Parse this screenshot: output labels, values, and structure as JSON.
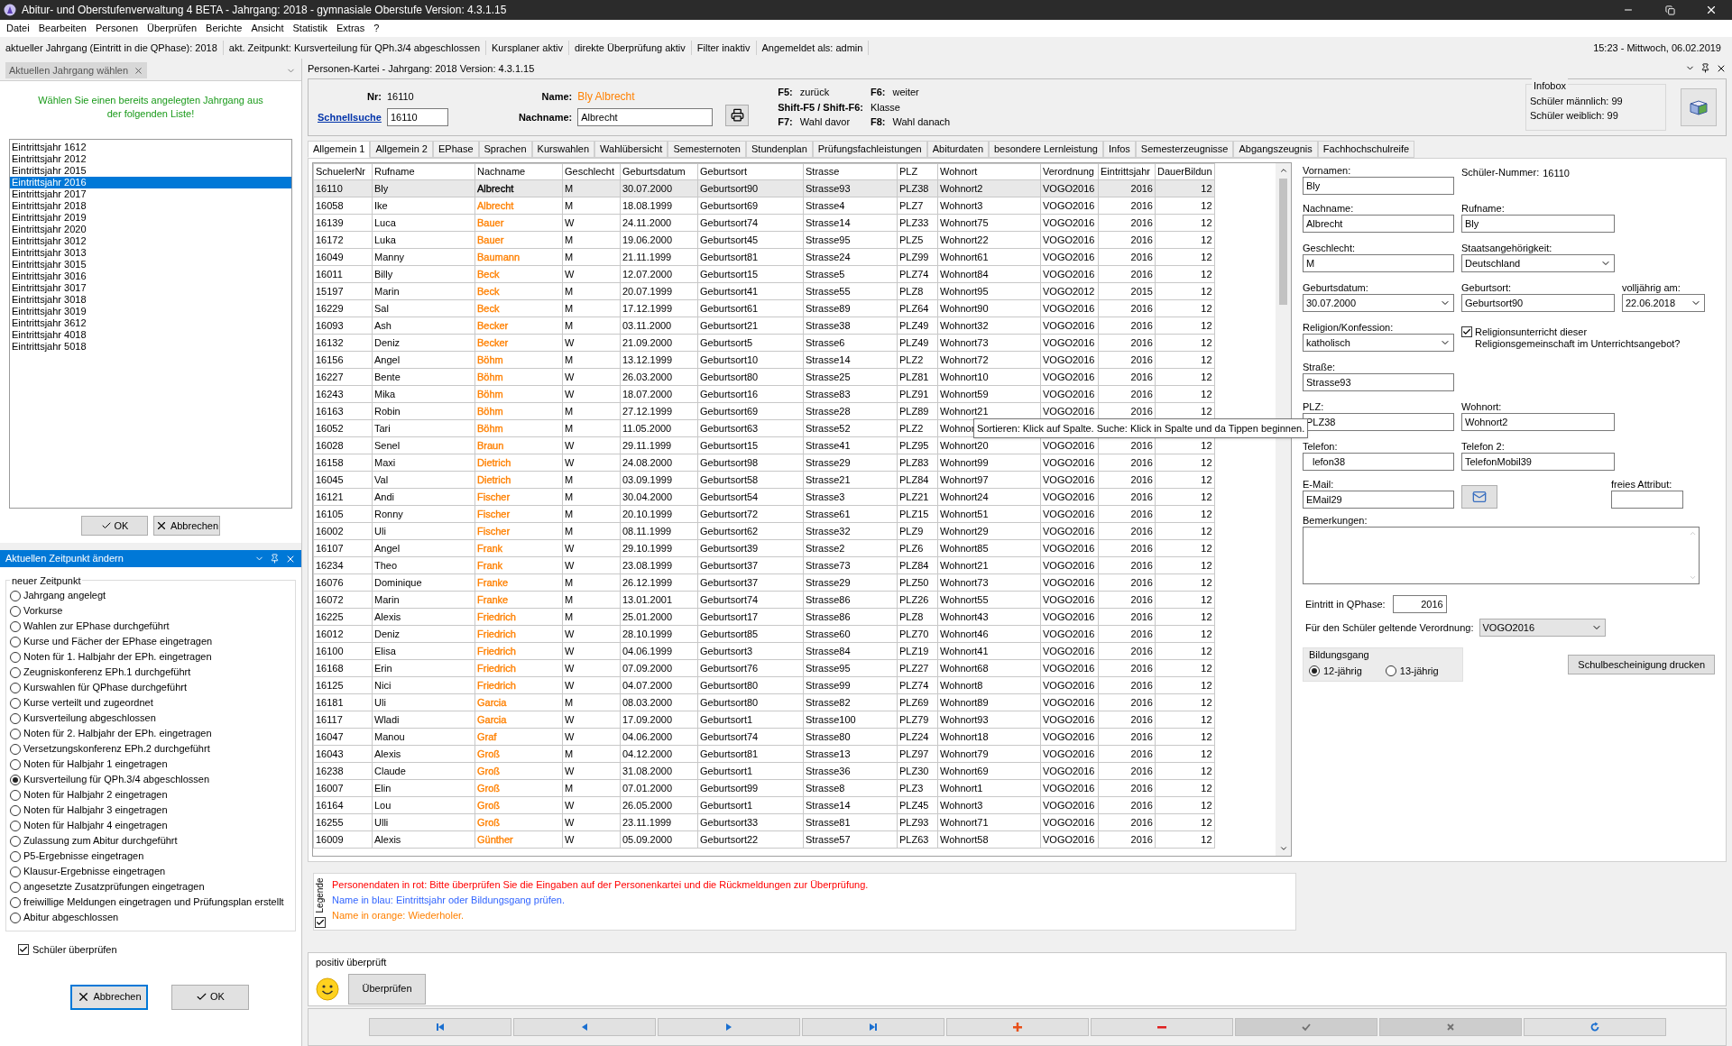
{
  "window": {
    "title": "Abitur- und Oberstufenverwaltung 4 BETA - Jahrgang: 2018 - gymnasiale Oberstufe Version: 4.3.1.15"
  },
  "menu": [
    "Datei",
    "Bearbeiten",
    "Personen",
    "Überprüfen",
    "Berichte",
    "Ansicht",
    "Statistik",
    "Extras",
    "?"
  ],
  "status": [
    "aktueller Jahrgang (Eintritt in die QPhase): 2018",
    "akt. Zeitpunkt: Kursverteilung für QPh.3/4 abgeschlossen",
    "Kursplaner aktiv",
    "direkte Überprüfung aktiv",
    "Filter inaktiv",
    "Angemeldet als: admin"
  ],
  "clock": "15:23 - Mittwoch, 06.02.2019",
  "year_panel": {
    "tab": "Aktuellen Jahrgang wählen",
    "hint": "Wählen Sie einen bereits angelegten Jahrgang  aus der folgenden Liste!",
    "buttons": [
      "OK",
      "Abbrechen"
    ],
    "items": [
      {
        "label": "Eintrittsjahr 1612",
        "selected": false
      },
      {
        "label": "Eintrittsjahr 2012",
        "selected": false
      },
      {
        "label": "Eintrittsjahr 2015",
        "selected": false
      },
      {
        "label": "Eintrittsjahr 2016",
        "selected": true
      },
      {
        "label": "Eintrittsjahr 2017",
        "selected": false
      },
      {
        "label": "Eintrittsjahr 2018",
        "selected": false
      },
      {
        "label": "Eintrittsjahr 2019",
        "selected": false
      },
      {
        "label": "Eintrittsjahr 2020",
        "selected": false
      },
      {
        "label": "Eintrittsjahr 3012",
        "selected": false
      },
      {
        "label": "Eintrittsjahr 3013",
        "selected": false
      },
      {
        "label": "Eintrittsjahr 3015",
        "selected": false
      },
      {
        "label": "Eintrittsjahr 3016",
        "selected": false
      },
      {
        "label": "Eintrittsjahr 3017",
        "selected": false
      },
      {
        "label": "Eintrittsjahr 3018",
        "selected": false
      },
      {
        "label": "Eintrittsjahr 3019",
        "selected": false
      },
      {
        "label": "Eintrittsjahr 3612",
        "selected": false
      },
      {
        "label": "Eintrittsjahr 4018",
        "selected": false
      },
      {
        "label": "Eintrittsjahr 5018",
        "selected": false
      }
    ]
  },
  "time_panel": {
    "title": "Aktuellen Zeitpunkt ändern",
    "group": "neuer Zeitpunkt",
    "check": {
      "label": "Schüler überprüfen",
      "checked": true
    },
    "buttons": [
      "Abbrechen",
      "OK"
    ],
    "options": [
      {
        "label": "Jahrgang angelegt",
        "selected": false
      },
      {
        "label": "Vorkurse",
        "selected": false
      },
      {
        "label": "Wahlen zur EPhase durchgeführt",
        "selected": false
      },
      {
        "label": "Kurse und Fächer der EPhase eingetragen",
        "selected": false
      },
      {
        "label": "Noten für 1. Halbjahr der EPh. eingetragen",
        "selected": false
      },
      {
        "label": "Zeugniskonferenz EPh.1 durchgeführt",
        "selected": false
      },
      {
        "label": "Kurswahlen für QPhase durchgeführt",
        "selected": false
      },
      {
        "label": "Kurse verteilt und zugeordnet",
        "selected": false
      },
      {
        "label": "Kursverteilung abgeschlossen",
        "selected": false
      },
      {
        "label": "Noten für 2. Halbjahr der EPh. eingetragen",
        "selected": false
      },
      {
        "label": "Versetzungskonferenz EPh.2 durchgeführt",
        "selected": false
      },
      {
        "label": "Noten für Halbjahr 1 eingetragen",
        "selected": false
      },
      {
        "label": "Kursverteilung für QPh.3/4 abgeschlossen",
        "selected": true
      },
      {
        "label": "Noten für Halbjahr 2 eingetragen",
        "selected": false
      },
      {
        "label": "Noten für Halbjahr 3 eingetragen",
        "selected": false
      },
      {
        "label": "Noten für Halbjahr 4 eingetragen",
        "selected": false
      },
      {
        "label": "Zulassung zum Abitur durchgeführt",
        "selected": false
      },
      {
        "label": "P5-Ergebnisse eingetragen",
        "selected": false
      },
      {
        "label": "Klausur-Ergebnisse eingetragen",
        "selected": false
      },
      {
        "label": "angesetzte Zusatzprüfungen eingetragen",
        "selected": false
      },
      {
        "label": "freiwillige Meldungen eingetragen und Prüfungsplan erstellt",
        "selected": false
      },
      {
        "label": "Abitur abgeschlossen",
        "selected": false
      }
    ]
  },
  "card": {
    "title": "Personen-Kartei - Jahrgang: 2018 Version: 4.3.1.15",
    "nr_label": "Nr:",
    "nr": "16110",
    "name_label": "Name:",
    "name": "Bly Albrecht",
    "quick_label": "Schnellsuche",
    "quick_value": "16110",
    "surname_label": "Nachname:",
    "surname_value": "Albrecht",
    "shortcuts": [
      [
        {
          "key": "F5:",
          "text": "zurück"
        },
        {
          "key": "F6:",
          "text": "weiter"
        }
      ],
      [
        {
          "key": "Shift-F5 / Shift-F6:",
          "text": "Klasse"
        }
      ],
      [
        {
          "key": "F7:",
          "text": "Wahl davor"
        },
        {
          "key": "F8:",
          "text": "Wahl danach"
        }
      ]
    ],
    "infobox": {
      "title": "Infobox",
      "lines": [
        "Schüler männlich: 99",
        "Schüler weiblich: 99"
      ]
    }
  },
  "tabs": [
    {
      "label": "Allgemein 1",
      "selected": true
    },
    {
      "label": "Allgemein 2",
      "selected": false
    },
    {
      "label": "EPhase",
      "selected": false
    },
    {
      "label": "Sprachen",
      "selected": false
    },
    {
      "label": "Kurswahlen",
      "selected": false
    },
    {
      "label": "Wahlübersicht",
      "selected": false
    },
    {
      "label": "Semesternoten",
      "selected": false
    },
    {
      "label": "Stundenplan",
      "selected": false
    },
    {
      "label": "Prüfungsfachleistungen",
      "selected": false
    },
    {
      "label": "Abiturdaten",
      "selected": false
    },
    {
      "label": "besondere Lernleistung",
      "selected": false
    },
    {
      "label": "Infos",
      "selected": false
    },
    {
      "label": "Semesterzeugnisse",
      "selected": false
    },
    {
      "label": "Abgangszeugnis",
      "selected": false
    },
    {
      "label": "Fachhochschulreife",
      "selected": false
    }
  ],
  "table": {
    "columns": [
      "SchuelerNr",
      "Rufname",
      "Nachname",
      "Geschlecht",
      "Geburtsdatum",
      "Geburtsort",
      "Strasse",
      "PLZ",
      "Wohnort",
      "Verordnung",
      "Eintrittsjahr",
      "DauerBildun"
    ],
    "rows": [
      {
        "selected": true,
        "color": "#000000",
        "cells": [
          "16110",
          "Bly",
          "Albrecht",
          "M",
          "30.07.2000",
          "Geburtsort90",
          "Strasse93",
          "PLZ38",
          "Wohnort2",
          "VOGO2016",
          "2016",
          "12"
        ]
      },
      {
        "selected": false,
        "color": "#ff8000",
        "cells": [
          "16058",
          "Ike",
          "Albrecht",
          "M",
          "18.08.1999",
          "Geburtsort69",
          "Strasse4",
          "PLZ7",
          "Wohnort3",
          "VOGO2016",
          "2016",
          "12"
        ]
      },
      {
        "selected": false,
        "color": "#ff8000",
        "cells": [
          "16139",
          "Luca",
          "Bauer",
          "W",
          "24.11.2000",
          "Geburtsort74",
          "Strasse14",
          "PLZ33",
          "Wohnort75",
          "VOGO2016",
          "2016",
          "12"
        ]
      },
      {
        "selected": false,
        "color": "#ff8000",
        "cells": [
          "16172",
          "Luka",
          "Bauer",
          "M",
          "19.06.2000",
          "Geburtsort45",
          "Strasse95",
          "PLZ5",
          "Wohnort22",
          "VOGO2016",
          "2016",
          "12"
        ]
      },
      {
        "selected": false,
        "color": "#ff8000",
        "cells": [
          "16049",
          "Manny",
          "Baumann",
          "M",
          "21.11.1999",
          "Geburtsort81",
          "Strasse24",
          "PLZ99",
          "Wohnort61",
          "VOGO2016",
          "2016",
          "12"
        ]
      },
      {
        "selected": false,
        "color": "#ff8000",
        "cells": [
          "16011",
          "Billy",
          "Beck",
          "W",
          "12.07.2000",
          "Geburtsort15",
          "Strasse5",
          "PLZ74",
          "Wohnort84",
          "VOGO2016",
          "2016",
          "12"
        ]
      },
      {
        "selected": false,
        "color": "#ff8000",
        "cells": [
          "15197",
          "Marin",
          "Beck",
          "M",
          "20.07.1999",
          "Geburtsort41",
          "Strasse55",
          "PLZ8",
          "Wohnort95",
          "VOGO2012",
          "2015",
          "12"
        ]
      },
      {
        "selected": false,
        "color": "#ff8000",
        "cells": [
          "16229",
          "Sal",
          "Beck",
          "M",
          "17.12.1999",
          "Geburtsort61",
          "Strasse89",
          "PLZ64",
          "Wohnort90",
          "VOGO2016",
          "2016",
          "12"
        ]
      },
      {
        "selected": false,
        "color": "#ff8000",
        "cells": [
          "16093",
          "Ash",
          "Becker",
          "M",
          "03.11.2000",
          "Geburtsort21",
          "Strasse38",
          "PLZ49",
          "Wohnort32",
          "VOGO2016",
          "2016",
          "12"
        ]
      },
      {
        "selected": false,
        "color": "#ff8000",
        "cells": [
          "16132",
          "Deniz",
          "Becker",
          "W",
          "21.09.2000",
          "Geburtsort5",
          "Strasse6",
          "PLZ49",
          "Wohnort73",
          "VOGO2016",
          "2016",
          "12"
        ]
      },
      {
        "selected": false,
        "color": "#ff8000",
        "cells": [
          "16156",
          "Angel",
          "Böhm",
          "M",
          "13.12.1999",
          "Geburtsort10",
          "Strasse14",
          "PLZ2",
          "Wohnort72",
          "VOGO2016",
          "2016",
          "12"
        ]
      },
      {
        "selected": false,
        "color": "#ff8000",
        "cells": [
          "16227",
          "Bente",
          "Böhm",
          "W",
          "26.03.2000",
          "Geburtsort80",
          "Strasse25",
          "PLZ81",
          "Wohnort10",
          "VOGO2016",
          "2016",
          "12"
        ]
      },
      {
        "selected": false,
        "color": "#ff8000",
        "cells": [
          "16243",
          "Mika",
          "Böhm",
          "W",
          "18.07.2000",
          "Geburtsort16",
          "Strasse83",
          "PLZ91",
          "Wohnort59",
          "VOGO2016",
          "2016",
          "12"
        ]
      },
      {
        "selected": false,
        "color": "#ff8000",
        "cells": [
          "16163",
          "Robin",
          "Böhm",
          "M",
          "27.12.1999",
          "Geburtsort69",
          "Strasse28",
          "PLZ89",
          "Wohnort21",
          "VOGO2016",
          "2016",
          "12"
        ]
      },
      {
        "selected": false,
        "color": "#ff8000",
        "cells": [
          "16052",
          "Tari",
          "Böhm",
          "M",
          "11.05.2000",
          "Geburtsort63",
          "Strasse52",
          "PLZ2",
          "Wohnor"
        ]
      },
      {
        "selected": false,
        "color": "#ff8000",
        "cells": [
          "16028",
          "Senel",
          "Braun",
          "W",
          "29.11.1999",
          "Geburtsort15",
          "Strasse41",
          "PLZ95",
          "Wohnort20",
          "VOGO2016",
          "2016",
          "12"
        ]
      },
      {
        "selected": false,
        "color": "#ff8000",
        "cells": [
          "16158",
          "Maxi",
          "Dietrich",
          "W",
          "24.08.2000",
          "Geburtsort98",
          "Strasse29",
          "PLZ83",
          "Wohnort99",
          "VOGO2016",
          "2016",
          "12"
        ]
      },
      {
        "selected": false,
        "color": "#ff8000",
        "cells": [
          "16045",
          "Val",
          "Dietrich",
          "M",
          "03.09.1999",
          "Geburtsort58",
          "Strasse21",
          "PLZ84",
          "Wohnort97",
          "VOGO2016",
          "2016",
          "12"
        ]
      },
      {
        "selected": false,
        "color": "#ff8000",
        "cells": [
          "16121",
          "Andi",
          "Fischer",
          "M",
          "30.04.2000",
          "Geburtsort54",
          "Strasse3",
          "PLZ21",
          "Wohnort24",
          "VOGO2016",
          "2016",
          "12"
        ]
      },
      {
        "selected": false,
        "color": "#ff8000",
        "cells": [
          "16105",
          "Ronny",
          "Fischer",
          "M",
          "20.10.1999",
          "Geburtsort72",
          "Strasse61",
          "PLZ15",
          "Wohnort51",
          "VOGO2016",
          "2016",
          "12"
        ]
      },
      {
        "selected": false,
        "color": "#ff8000",
        "cells": [
          "16002",
          "Uli",
          "Fischer",
          "M",
          "08.11.1999",
          "Geburtsort62",
          "Strasse32",
          "PLZ9",
          "Wohnort29",
          "VOGO2016",
          "2016",
          "12"
        ]
      },
      {
        "selected": false,
        "color": "#ff8000",
        "cells": [
          "16107",
          "Angel",
          "Frank",
          "W",
          "29.10.1999",
          "Geburtsort39",
          "Strasse2",
          "PLZ6",
          "Wohnort85",
          "VOGO2016",
          "2016",
          "12"
        ]
      },
      {
        "selected": false,
        "color": "#ff8000",
        "cells": [
          "16234",
          "Theo",
          "Frank",
          "W",
          "23.08.1999",
          "Geburtsort37",
          "Strasse73",
          "PLZ84",
          "Wohnort21",
          "VOGO2016",
          "2016",
          "12"
        ]
      },
      {
        "selected": false,
        "color": "#ff8000",
        "cells": [
          "16076",
          "Dominique",
          "Franke",
          "M",
          "26.12.1999",
          "Geburtsort37",
          "Strasse29",
          "PLZ50",
          "Wohnort73",
          "VOGO2016",
          "2016",
          "12"
        ]
      },
      {
        "selected": false,
        "color": "#ff8000",
        "cells": [
          "16072",
          "Marin",
          "Franke",
          "M",
          "13.01.2001",
          "Geburtsort74",
          "Strasse86",
          "PLZ26",
          "Wohnort55",
          "VOGO2016",
          "2016",
          "12"
        ]
      },
      {
        "selected": false,
        "color": "#ff8000",
        "cells": [
          "16225",
          "Alexis",
          "Friedrich",
          "M",
          "25.01.2000",
          "Geburtsort17",
          "Strasse86",
          "PLZ8",
          "Wohnort43",
          "VOGO2016",
          "2016",
          "12"
        ]
      },
      {
        "selected": false,
        "color": "#ff8000",
        "cells": [
          "16012",
          "Deniz",
          "Friedrich",
          "W",
          "28.10.1999",
          "Geburtsort85",
          "Strasse60",
          "PLZ70",
          "Wohnort46",
          "VOGO2016",
          "2016",
          "12"
        ]
      },
      {
        "selected": false,
        "color": "#ff8000",
        "cells": [
          "16100",
          "Elisa",
          "Friedrich",
          "W",
          "04.06.1999",
          "Geburtsort3",
          "Strasse84",
          "PLZ19",
          "Wohnort41",
          "VOGO2016",
          "2016",
          "12"
        ]
      },
      {
        "selected": false,
        "color": "#ff8000",
        "cells": [
          "16168",
          "Erin",
          "Friedrich",
          "W",
          "07.09.2000",
          "Geburtsort76",
          "Strasse95",
          "PLZ27",
          "Wohnort68",
          "VOGO2016",
          "2016",
          "12"
        ]
      },
      {
        "selected": false,
        "color": "#ff8000",
        "cells": [
          "16125",
          "Nici",
          "Friedrich",
          "W",
          "04.07.2000",
          "Geburtsort80",
          "Strasse99",
          "PLZ74",
          "Wohnort8",
          "VOGO2016",
          "2016",
          "12"
        ]
      },
      {
        "selected": false,
        "color": "#ff8000",
        "cells": [
          "16181",
          "Uli",
          "Garcia",
          "M",
          "08.03.2000",
          "Geburtsort80",
          "Strasse82",
          "PLZ69",
          "Wohnort89",
          "VOGO2016",
          "2016",
          "12"
        ]
      },
      {
        "selected": false,
        "color": "#ff8000",
        "cells": [
          "16117",
          "Wladi",
          "Garcia",
          "W",
          "17.09.2000",
          "Geburtsort1",
          "Strasse100",
          "PLZ79",
          "Wohnort93",
          "VOGO2016",
          "2016",
          "12"
        ]
      },
      {
        "selected": false,
        "color": "#ff8000",
        "cells": [
          "16047",
          "Manou",
          "Graf",
          "W",
          "04.06.2000",
          "Geburtsort74",
          "Strasse80",
          "PLZ24",
          "Wohnort18",
          "VOGO2016",
          "2016",
          "12"
        ]
      },
      {
        "selected": false,
        "color": "#ff8000",
        "cells": [
          "16043",
          "Alexis",
          "Groß",
          "M",
          "04.12.2000",
          "Geburtsort81",
          "Strasse13",
          "PLZ97",
          "Wohnort79",
          "VOGO2016",
          "2016",
          "12"
        ]
      },
      {
        "selected": false,
        "color": "#ff8000",
        "cells": [
          "16238",
          "Claude",
          "Groß",
          "W",
          "31.08.2000",
          "Geburtsort1",
          "Strasse36",
          "PLZ30",
          "Wohnort69",
          "VOGO2016",
          "2016",
          "12"
        ]
      },
      {
        "selected": false,
        "color": "#ff8000",
        "cells": [
          "16007",
          "Elin",
          "Groß",
          "M",
          "07.01.2000",
          "Geburtsort99",
          "Strasse8",
          "PLZ3",
          "Wohnort1",
          "VOGO2016",
          "2016",
          "12"
        ]
      },
      {
        "selected": false,
        "color": "#ff8000",
        "cells": [
          "16164",
          "Lou",
          "Groß",
          "W",
          "26.05.2000",
          "Geburtsort1",
          "Strasse14",
          "PLZ45",
          "Wohnort3",
          "VOGO2016",
          "2016",
          "12"
        ]
      },
      {
        "selected": false,
        "color": "#ff8000",
        "cells": [
          "16255",
          "Ulli",
          "Groß",
          "W",
          "23.11.1999",
          "Geburtsort33",
          "Strasse81",
          "PLZ93",
          "Wohnort71",
          "VOGO2016",
          "2016",
          "12"
        ]
      },
      {
        "selected": false,
        "color": "#ff8000",
        "cells": [
          "16009",
          "Alexis",
          "Günther",
          "W",
          "05.09.2000",
          "Geburtsort22",
          "Strasse57",
          "PLZ63",
          "Wohnort58",
          "VOGO2016",
          "2016",
          "12"
        ]
      }
    ]
  },
  "tooltip": "Sortieren: Klick auf Spalte. Suche: Klick in Spalte und da Tippen beginnen.",
  "form": {
    "vornamen": {
      "label": "Vornamen:",
      "value": "Bly"
    },
    "schueler_nr": {
      "label": "Schüler-Nummer:",
      "value": "16110"
    },
    "nachname": {
      "label": "Nachname:",
      "value": "Albrecht"
    },
    "rufname": {
      "label": "Rufname:",
      "value": "Bly"
    },
    "geschlecht": {
      "label": "Geschlecht:",
      "value": "M"
    },
    "staat": {
      "label": "Staatsangehörigkeit:",
      "value": "Deutschland"
    },
    "geburtsdatum": {
      "label": "Geburtsdatum:",
      "value": "30.07.2000"
    },
    "geburtsort": {
      "label": "Geburtsort:",
      "value": "Geburtsort90"
    },
    "volljaehrig": {
      "label": "volljährig am:",
      "value": "22.06.2018"
    },
    "religion": {
      "label": "Religion/Konfession:",
      "value": "katholisch"
    },
    "religion_check": {
      "label": "Religionsunterricht dieser Religionsgemeinschaft im Unterrichtsangebot?",
      "checked": true
    },
    "strasse": {
      "label": "Straße:",
      "value": "Strasse93"
    },
    "plz": {
      "label": "PLZ:",
      "value": "PLZ38"
    },
    "wohnort": {
      "label": "Wohnort:",
      "value": "Wohnort2"
    },
    "telefon": {
      "label": "Telefon:",
      "value": "lefon38"
    },
    "telefon2": {
      "label": "Telefon 2:",
      "value": "TelefonMobil39"
    },
    "email": {
      "label": "E-Mail:",
      "value": "EMail29"
    },
    "freies_attribut": {
      "label": "freies Attribut:"
    },
    "bemerkungen": {
      "label": "Bemerkungen:"
    },
    "eintritt": {
      "label": "Eintritt in QPhase:",
      "value": "2016"
    },
    "verordnung": {
      "label": "Für den Schüler geltende Verordnung:",
      "value": "VOGO2016"
    },
    "bildungsgang": {
      "label": "Bildungsgang",
      "options": [
        {
          "label": "12-jährig",
          "selected": true
        },
        {
          "label": "13-jährig",
          "selected": false
        }
      ]
    },
    "print_button": "Schulbescheinigung drucken"
  },
  "legend": {
    "title": "Legende",
    "checked": true,
    "lines": [
      {
        "text": "Personendaten in rot: Bitte überprüfen Sie die Eingaben auf der Personenkartei und die Rückmeldungen zur Überprüfung.",
        "color": "#ff0000"
      },
      {
        "text": "Name in blau: Eintrittsjahr oder Bildungsgang prüfen.",
        "color": "#3366ff"
      },
      {
        "text": "Name in orange: Wiederholer.",
        "color": "#ff8000"
      }
    ]
  },
  "check_section": {
    "status": "positiv überprüft",
    "button": "Überprüfen"
  },
  "nav": [
    {
      "kind": "first",
      "disabled": false
    },
    {
      "kind": "prev",
      "disabled": false
    },
    {
      "kind": "next",
      "disabled": false
    },
    {
      "kind": "last",
      "disabled": false
    },
    {
      "kind": "add",
      "disabled": false
    },
    {
      "kind": "remove",
      "disabled": false
    },
    {
      "kind": "confirm",
      "disabled": true
    },
    {
      "kind": "cancel",
      "disabled": true
    },
    {
      "kind": "refresh",
      "disabled": false
    }
  ]
}
